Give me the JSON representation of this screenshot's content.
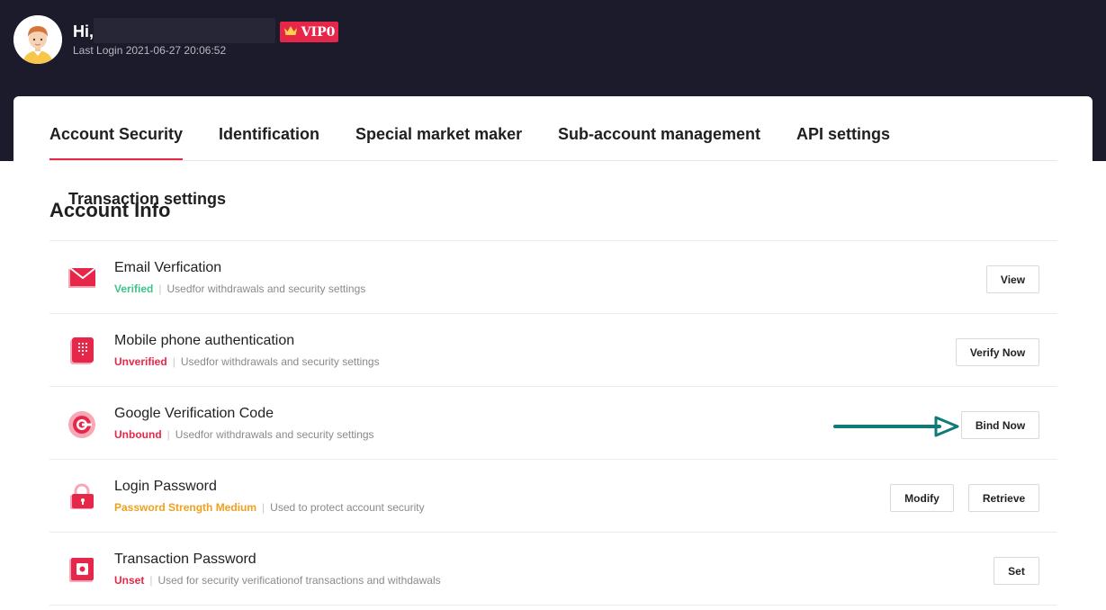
{
  "header": {
    "greeting": "Hi,",
    "vip_label": "VIP0",
    "last_login": "Last Login 2021-06-27 20:06:52",
    "colors": {
      "background": "#1b1b2b",
      "accent": "#e6274a"
    }
  },
  "tabs": [
    {
      "label": "Account Security",
      "active": true
    },
    {
      "label": "Identification",
      "active": false
    },
    {
      "label": "Special market maker",
      "active": false
    },
    {
      "label": "Sub-account management",
      "active": false
    },
    {
      "label": "API settings",
      "active": false
    },
    {
      "label": "Transaction settings",
      "active": false
    }
  ],
  "section_title": "Account Info",
  "rows": [
    {
      "title": "Email Verfication",
      "status": "Verified",
      "status_color": "#3cc48a",
      "description": "Usedfor withdrawals and security settings",
      "icon": "email-icon",
      "buttons": [
        "View"
      ]
    },
    {
      "title": "Mobile phone authentication",
      "status": "Unverified",
      "status_color": "#e6274a",
      "description": "Usedfor withdrawals and security settings",
      "icon": "mobile-phone-icon",
      "buttons": [
        "Verify Now"
      ]
    },
    {
      "title": "Google Verification Code",
      "status": "Unbound",
      "status_color": "#e6274a",
      "description": "Usedfor withdrawals and security settings",
      "icon": "google-authenticator-icon",
      "buttons": [
        "Bind Now"
      ]
    },
    {
      "title": "Login Password",
      "status": "Password Strength Medium",
      "status_color": "#f0a020",
      "description": "Used to protect account security",
      "icon": "padlock-icon",
      "buttons": [
        "Modify",
        "Retrieve"
      ]
    },
    {
      "title": "Transaction Password",
      "status": "Unset",
      "status_color": "#e6274a",
      "description": "Used for security verificationof transactions and withdawals",
      "icon": "safe-icon",
      "buttons": [
        "Set"
      ]
    }
  ],
  "annotation": {
    "icon": "arrow-right-icon",
    "color": "#0f7a78"
  }
}
